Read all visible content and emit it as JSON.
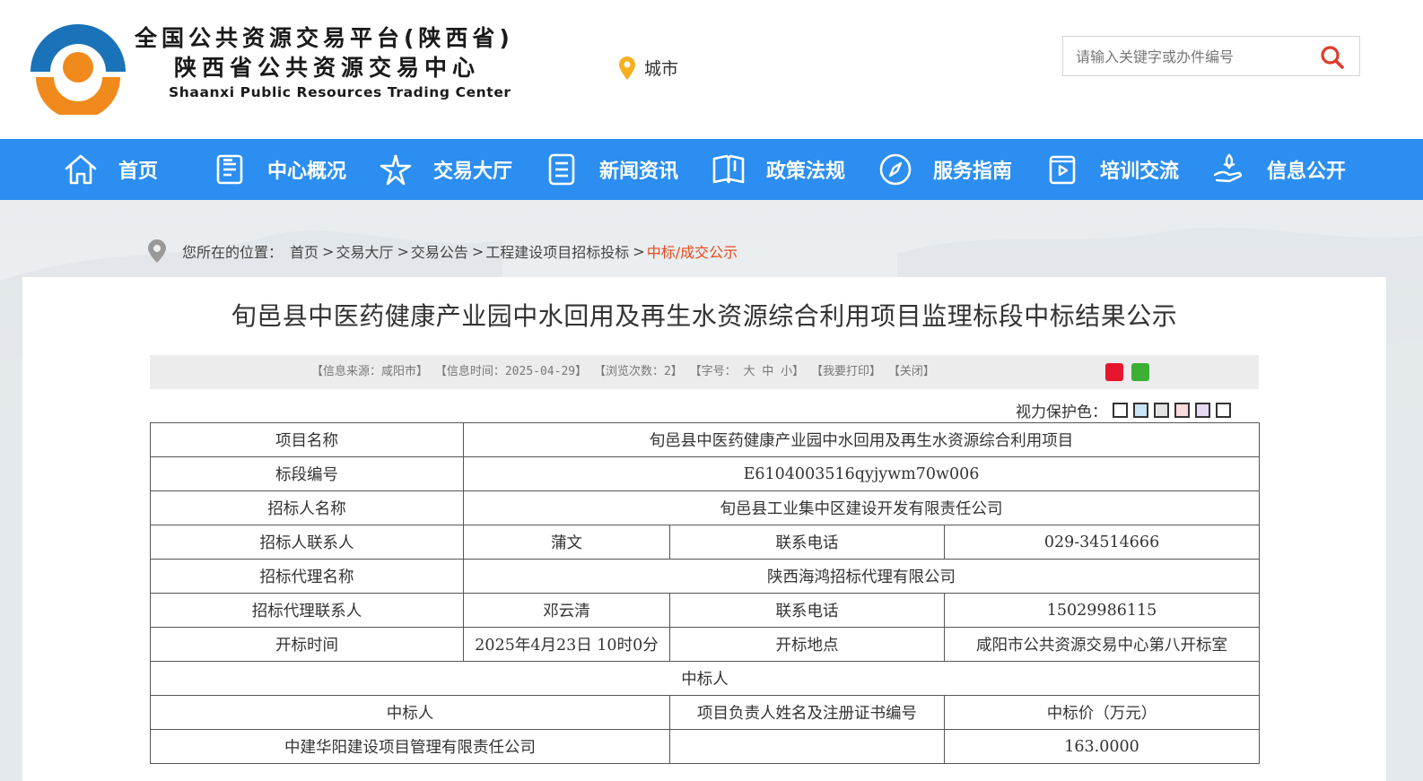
{
  "header": {
    "logo_line1": "全国公共资源交易平台(陕西省)",
    "logo_line2": "陕西省公共资源交易中心",
    "logo_en": "Shaanxi Public Resources Trading Center",
    "city_label": "城市",
    "search_placeholder": "请输入关键字或办件编号"
  },
  "colors": {
    "nav_bg": "#2b8ef0",
    "logo_blue": "#1a73b8",
    "logo_orange": "#f08a1c",
    "breadcrumb_current": "#e84a1a"
  },
  "nav": {
    "items": [
      {
        "label": "首页",
        "icon": "home-icon"
      },
      {
        "label": "中心概况",
        "icon": "document-icon"
      },
      {
        "label": "交易大厅",
        "icon": "star-icon"
      },
      {
        "label": "新闻资讯",
        "icon": "list-icon"
      },
      {
        "label": "政策法规",
        "icon": "book-icon"
      },
      {
        "label": "服务指南",
        "icon": "compass-icon"
      },
      {
        "label": "培训交流",
        "icon": "video-icon"
      },
      {
        "label": "信息公开",
        "icon": "hand-icon"
      }
    ]
  },
  "breadcrumb": {
    "prefix": "您所在的位置：",
    "items": [
      "首页",
      "交易大厅",
      "交易公告",
      "工程建设项目招标投标"
    ],
    "current": "中标/成交公示"
  },
  "article": {
    "title": "旬邑县中医药健康产业园中水回用及再生水资源综合利用项目监理标段中标结果公示",
    "meta": {
      "source": "【信息来源：咸阳市】",
      "time": "【信息时间：2025-04-29】",
      "views": "【浏览次数：2】",
      "font_prefix": "【字号：",
      "font_large": "大",
      "font_medium": "中",
      "font_small": "小】",
      "print": "【我要打印】",
      "close": "【关闭】"
    },
    "eye_label": "视力保护色：",
    "eye_colors": [
      "#ffffff",
      "#c9e4f5",
      "#e3e3e3",
      "#f8d9dd",
      "#e7d8f3",
      "#ffffff"
    ]
  },
  "table": {
    "project_name_label": "项目名称",
    "project_name": "旬邑县中医药健康产业园中水回用及再生水资源综合利用项目",
    "section_no_label": "标段编号",
    "section_no": "E6104003516qyjywm70w006",
    "tenderer_label": "招标人名称",
    "tenderer": "旬邑县工业集中区建设开发有限责任公司",
    "tenderer_contact_label": "招标人联系人",
    "tenderer_contact": "蒲文",
    "phone_label": "联系电话",
    "tenderer_phone": "029-34514666",
    "agency_label": "招标代理名称",
    "agency": "陕西海鸿招标代理有限公司",
    "agency_contact_label": "招标代理联系人",
    "agency_contact": "邓云清",
    "agency_phone": "15029986115",
    "open_time_label": "开标时间",
    "open_time": "2025年4月23日 10时0分",
    "open_place_label": "开标地点",
    "open_place": "咸阳市公共资源交易中心第八开标室",
    "winner_section": "中标人",
    "col_winner": "中标人",
    "col_manager": "项目负责人姓名及注册证书编号",
    "col_price": "中标价（万元）",
    "winner_name": "中建华阳建设项目管理有限责任公司",
    "winner_manager": "",
    "winner_price": "163.0000"
  }
}
